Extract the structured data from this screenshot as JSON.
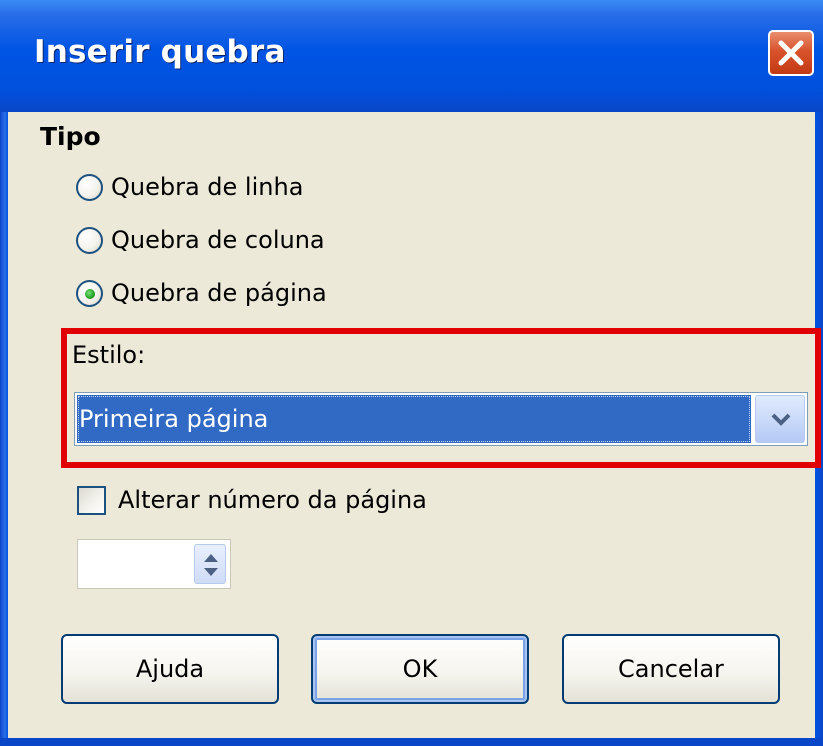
{
  "dialog": {
    "title": "Inserir quebra"
  },
  "type_section": {
    "title": "Tipo",
    "options": [
      {
        "label": "Quebra de  linha",
        "checked": false
      },
      {
        "label": "Quebra de coluna",
        "checked": false
      },
      {
        "label": "Quebra de página",
        "checked": true
      }
    ]
  },
  "style": {
    "label": "Estilo:",
    "selected": "Primeira página"
  },
  "page_number": {
    "checkbox_label": "Alterar número da página",
    "checked": false,
    "value": ""
  },
  "buttons": {
    "help": "Ajuda",
    "ok": "OK",
    "cancel": "Cancelar"
  },
  "icons": {
    "close": "close-icon",
    "dropdown": "chevron-down-icon",
    "spinner": "spin-arrows-icon"
  },
  "colors": {
    "title_bar": "#0054e3",
    "close_button": "#d8532c",
    "selection": "#316ac5",
    "highlight_border": "#e00000",
    "dialog_background": "#ece9d8"
  }
}
